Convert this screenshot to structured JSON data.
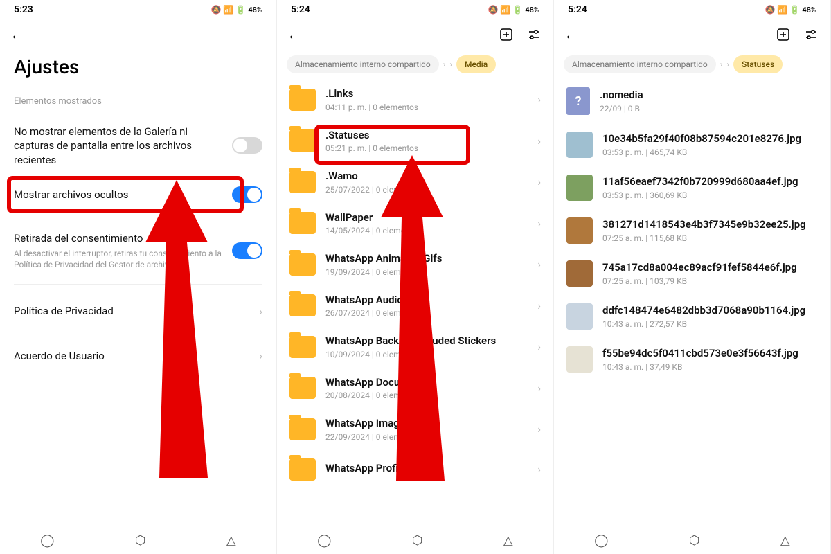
{
  "status": {
    "time1": "5:23",
    "time2": "5:24",
    "time3": "5:24",
    "battery": "48%"
  },
  "panel1": {
    "title": "Ajustes",
    "section": "Elementos mostrados",
    "row1": {
      "title": "No mostrar elementos de la Galería ni capturas de pantalla entre los archivos recientes",
      "on": false
    },
    "row2": {
      "title": "Mostrar archivos ocultos",
      "on": true
    },
    "row3": {
      "title": "Retirada del consentimiento",
      "sub": "Al desactivar el interruptor, retiras tu consentimiento a la Política de Privacidad del Gestor de archivos.",
      "on": true
    },
    "row4": {
      "title": "Política de Privacidad"
    },
    "row5": {
      "title": "Acuerdo de Usuario"
    }
  },
  "panel2": {
    "breadcrumb": {
      "root": "Almacenamiento interno compartido",
      "active": "Media"
    },
    "items": [
      {
        "name": ".Links",
        "meta": "04:11 p. m.  |  0 elementos"
      },
      {
        "name": ".Statuses",
        "meta": "05:21 p. m.  |  0 elementos"
      },
      {
        "name": ".Wamo",
        "meta": "25/07/2022  |  0 elementos"
      },
      {
        "name": "WallPaper",
        "meta": "14/05/2024  |  0 elementos"
      },
      {
        "name": "WhatsApp Animated Gifs",
        "meta": "19/09/2024  |  0 elementos"
      },
      {
        "name": "WhatsApp Audio",
        "meta": "26/07/2024  |  0 elementos"
      },
      {
        "name": "WhatsApp Backup Excluded Stickers",
        "meta": "10/09/2024  |  0 elementos"
      },
      {
        "name": "WhatsApp Documents",
        "meta": "20/08/2024  |  0 elementos"
      },
      {
        "name": "WhatsApp Images",
        "meta": "22/09/2024  |  0 elementos"
      },
      {
        "name": "WhatsApp Profile Photos",
        "meta": ""
      }
    ]
  },
  "panel3": {
    "breadcrumb": {
      "root": "Almacenamiento interno compartido",
      "active": "Statuses"
    },
    "items": [
      {
        "name": ".nomedia",
        "meta": "22/09  |  0 B",
        "kind": "file"
      },
      {
        "name": "10e34b5fa29f40f08b87594c201e8276.jpg",
        "meta": "03:53 p. m.  |  465,74 KB",
        "kind": "thumb",
        "bg": "#9fbfd0"
      },
      {
        "name": "11af56eaef7342f0b720999d680aa4ef.jpg",
        "meta": "03:53 p. m.  |  360,69 KB",
        "kind": "thumb",
        "bg": "#7da060"
      },
      {
        "name": "381271d1418543e4b3f7345e9b32ee25.jpg",
        "meta": "07:25 a. m.  |  115,68 KB",
        "kind": "thumb",
        "bg": "#b0783c"
      },
      {
        "name": "745a17cd8a004ec89acf91fef5844e6f.jpg",
        "meta": "07:25 a. m.  |  103,79 KB",
        "kind": "thumb",
        "bg": "#a06a38"
      },
      {
        "name": "ddfc148474e6482dbb3d7068a90b1164.jpg",
        "meta": "10:43 a. m.  |  272,57 KB",
        "kind": "thumb",
        "bg": "#c8d4e0"
      },
      {
        "name": "f55be94dc5f0411cbd573e0e3f56643f.jpg",
        "meta": "10:43 a. m.  |  37,49 KB",
        "kind": "thumb",
        "bg": "#e6e2d4"
      }
    ]
  }
}
